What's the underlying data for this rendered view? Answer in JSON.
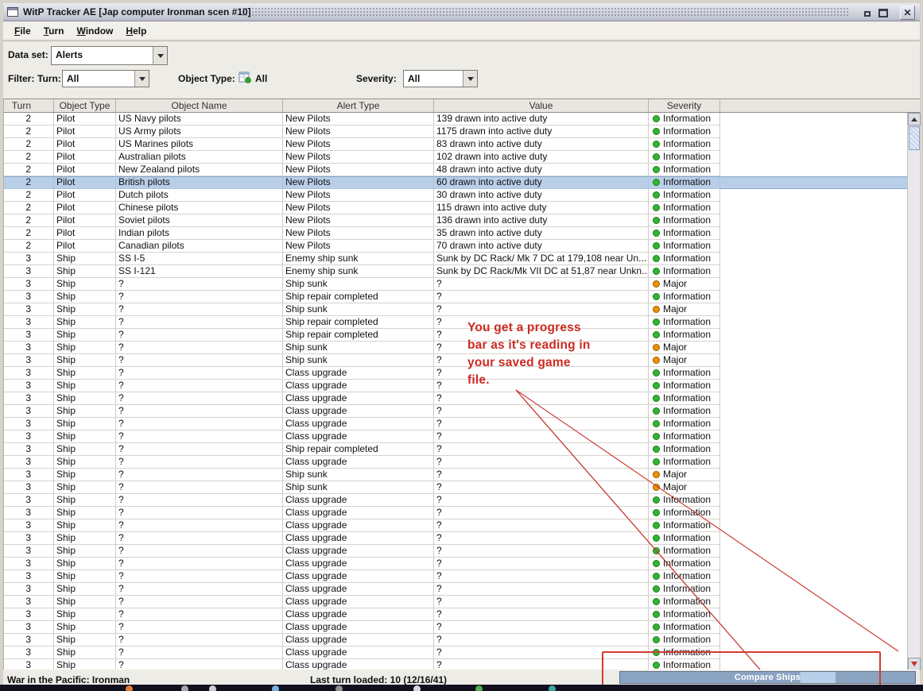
{
  "window": {
    "title": "WitP Tracker AE [Jap computer Ironman scen #10]"
  },
  "menu": {
    "items": [
      "File",
      "Turn",
      "Window",
      "Help"
    ]
  },
  "dataset": {
    "label": "Data set:",
    "value": "Alerts"
  },
  "filters": {
    "label": "Filter:",
    "turn_label": "Turn:",
    "turn_value": "All",
    "object_type_label": "Object Type:",
    "object_type_value": "All",
    "severity_label": "Severity:",
    "severity_value": "All"
  },
  "table": {
    "columns": [
      "Turn",
      "Object Type",
      "Object Name",
      "Alert Type",
      "Value",
      "Severity"
    ],
    "selected_row_index": 5,
    "rows": [
      [
        "2",
        "Pilot",
        "US Navy pilots",
        "New Pilots",
        "139 drawn into active duty",
        "Information"
      ],
      [
        "2",
        "Pilot",
        "US Army pilots",
        "New Pilots",
        "1175 drawn into active duty",
        "Information"
      ],
      [
        "2",
        "Pilot",
        "US Marines pilots",
        "New Pilots",
        "83 drawn into active duty",
        "Information"
      ],
      [
        "2",
        "Pilot",
        "Australian pilots",
        "New Pilots",
        "102 drawn into active duty",
        "Information"
      ],
      [
        "2",
        "Pilot",
        "New Zealand pilots",
        "New Pilots",
        "48 drawn into active duty",
        "Information"
      ],
      [
        "2",
        "Pilot",
        "British pilots",
        "New Pilots",
        "60 drawn into active duty",
        "Information"
      ],
      [
        "2",
        "Pilot",
        "Dutch pilots",
        "New Pilots",
        "30 drawn into active duty",
        "Information"
      ],
      [
        "2",
        "Pilot",
        "Chinese pilots",
        "New Pilots",
        "115 drawn into active duty",
        "Information"
      ],
      [
        "2",
        "Pilot",
        "Soviet pilots",
        "New Pilots",
        "136 drawn into active duty",
        "Information"
      ],
      [
        "2",
        "Pilot",
        "Indian pilots",
        "New Pilots",
        "35 drawn into active duty",
        "Information"
      ],
      [
        "2",
        "Pilot",
        "Canadian pilots",
        "New Pilots",
        "70 drawn into active duty",
        "Information"
      ],
      [
        "3",
        "Ship",
        "SS I-5",
        "Enemy ship sunk",
        "Sunk by DC Rack/ Mk 7 DC at 179,108 near Un...",
        "Information"
      ],
      [
        "3",
        "Ship",
        "SS I-121",
        "Enemy ship sunk",
        "Sunk by DC Rack/Mk VII DC at 51,87 near Unkn...",
        "Information"
      ],
      [
        "3",
        "Ship",
        "?",
        "Ship sunk",
        "?",
        "Major"
      ],
      [
        "3",
        "Ship",
        "?",
        "Ship repair completed",
        "?",
        "Information"
      ],
      [
        "3",
        "Ship",
        "?",
        "Ship sunk",
        "?",
        "Major"
      ],
      [
        "3",
        "Ship",
        "?",
        "Ship repair completed",
        "?",
        "Information"
      ],
      [
        "3",
        "Ship",
        "?",
        "Ship repair completed",
        "?",
        "Information"
      ],
      [
        "3",
        "Ship",
        "?",
        "Ship sunk",
        "?",
        "Major"
      ],
      [
        "3",
        "Ship",
        "?",
        "Ship sunk",
        "?",
        "Major"
      ],
      [
        "3",
        "Ship",
        "?",
        "Class upgrade",
        "?",
        "Information"
      ],
      [
        "3",
        "Ship",
        "?",
        "Class upgrade",
        "?",
        "Information"
      ],
      [
        "3",
        "Ship",
        "?",
        "Class upgrade",
        "?",
        "Information"
      ],
      [
        "3",
        "Ship",
        "?",
        "Class upgrade",
        "?",
        "Information"
      ],
      [
        "3",
        "Ship",
        "?",
        "Class upgrade",
        "?",
        "Information"
      ],
      [
        "3",
        "Ship",
        "?",
        "Class upgrade",
        "?",
        "Information"
      ],
      [
        "3",
        "Ship",
        "?",
        "Ship repair completed",
        "?",
        "Information"
      ],
      [
        "3",
        "Ship",
        "?",
        "Class upgrade",
        "?",
        "Information"
      ],
      [
        "3",
        "Ship",
        "?",
        "Ship sunk",
        "?",
        "Major"
      ],
      [
        "3",
        "Ship",
        "?",
        "Ship sunk",
        "?",
        "Major"
      ],
      [
        "3",
        "Ship",
        "?",
        "Class upgrade",
        "?",
        "Information"
      ],
      [
        "3",
        "Ship",
        "?",
        "Class upgrade",
        "?",
        "Information"
      ],
      [
        "3",
        "Ship",
        "?",
        "Class upgrade",
        "?",
        "Information"
      ],
      [
        "3",
        "Ship",
        "?",
        "Class upgrade",
        "?",
        "Information"
      ],
      [
        "3",
        "Ship",
        "?",
        "Class upgrade",
        "?",
        "Information"
      ],
      [
        "3",
        "Ship",
        "?",
        "Class upgrade",
        "?",
        "Information"
      ],
      [
        "3",
        "Ship",
        "?",
        "Class upgrade",
        "?",
        "Information"
      ],
      [
        "3",
        "Ship",
        "?",
        "Class upgrade",
        "?",
        "Information"
      ],
      [
        "3",
        "Ship",
        "?",
        "Class upgrade",
        "?",
        "Information"
      ],
      [
        "3",
        "Ship",
        "?",
        "Class upgrade",
        "?",
        "Information"
      ],
      [
        "3",
        "Ship",
        "?",
        "Class upgrade",
        "?",
        "Information"
      ],
      [
        "3",
        "Ship",
        "?",
        "Class upgrade",
        "?",
        "Information"
      ],
      [
        "3",
        "Ship",
        "?",
        "Class upgrade",
        "?",
        "Information"
      ],
      [
        "3",
        "Ship",
        "?",
        "Class upgrade",
        "?",
        "Information"
      ]
    ]
  },
  "severity_colors": {
    "Information": "#2eb82e",
    "Major": "#f09000"
  },
  "annotation": {
    "color": "#cc2a22",
    "lines": [
      "You get a progress",
      "bar as it's reading in",
      "your saved game",
      "file."
    ]
  },
  "progress": {
    "label": "Compare Ships"
  },
  "statusbar": {
    "left": "War in the Pacific: Ironman",
    "center": "Last turn loaded: 10 (12/16/41)"
  }
}
